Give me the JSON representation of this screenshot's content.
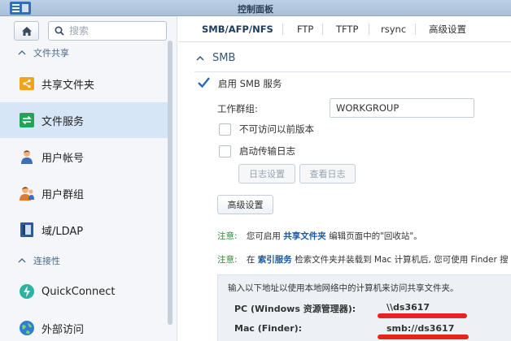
{
  "window": {
    "title": "控制面板"
  },
  "sidebar": {
    "search_placeholder": "搜索",
    "sections": [
      {
        "label": "文件共享"
      },
      {
        "label": "连接性"
      }
    ],
    "items": [
      {
        "label": "共享文件夹",
        "icon": "share-folder-icon"
      },
      {
        "label": "文件服务",
        "icon": "file-services-icon",
        "active": true
      },
      {
        "label": "用户帐号",
        "icon": "user-icon"
      },
      {
        "label": "用户群组",
        "icon": "group-icon"
      },
      {
        "label": "域/LDAP",
        "icon": "domain-icon"
      },
      {
        "label": "QuickConnect",
        "icon": "quickconnect-icon"
      },
      {
        "label": "外部访问",
        "icon": "globe-icon"
      }
    ]
  },
  "tabs": [
    {
      "label": "SMB/AFP/NFS",
      "active": true
    },
    {
      "label": "FTP"
    },
    {
      "label": "TFTP"
    },
    {
      "label": "rsync"
    },
    {
      "label": "高级设置"
    }
  ],
  "smb": {
    "section_title": "SMB",
    "enable_label": "启用 SMB 服务",
    "enable_checked": true,
    "workgroup_label": "工作群组:",
    "workgroup_value": "WORKGROUP",
    "no_prev_versions_label": "不可访问以前版本",
    "enable_transfer_log_label": "启动传输日志",
    "log_settings_button": "日志设置",
    "view_log_button": "查看日志",
    "advanced_button": "高级设置",
    "note1": {
      "tag": "注意:",
      "pre": "您可启用",
      "link": "共享文件夹",
      "post": "编辑页面中的\"回收站\"。"
    },
    "note2": {
      "tag": "注意:",
      "pre": "在",
      "link": "索引服务",
      "post": "检索文件夹并装载到 Mac 计算机后, 您可使用 Finder 搜"
    },
    "access_intro": "输入以下地址以使用本地网络中的计算机来访问共享文件夹。",
    "pc_label": "PC (Windows 资源管理器):",
    "pc_value": "\\\\ds3617",
    "mac_label": "Mac (Finder):",
    "mac_value": "smb://ds3617"
  },
  "colors": {
    "accent": "#1a5aa8",
    "note_tag": "#2a8a36",
    "highlight": "#e8231e",
    "active_bg": "#d7e6f6"
  }
}
